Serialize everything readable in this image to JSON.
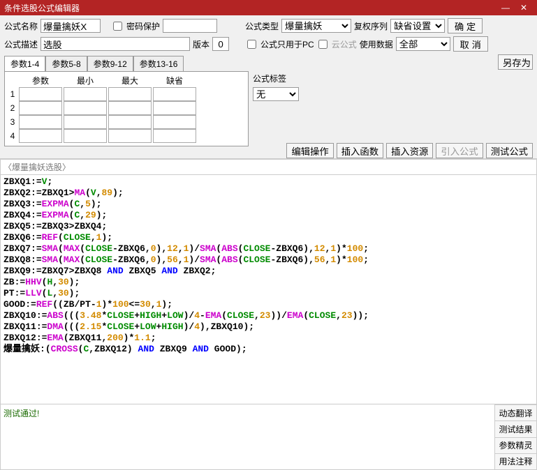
{
  "window": {
    "title": "条件选股公式编辑器"
  },
  "labels": {
    "name": "公式名称",
    "pwd": "密码保护",
    "type": "公式类型",
    "seq": "复权序列",
    "desc": "公式描述",
    "ver": "版本",
    "pconly": "公式只用于PC",
    "cloud": "云公式",
    "usedata": "使用数据",
    "tag": "公式标签"
  },
  "fields": {
    "name": "爆量擒妖X",
    "desc": "选股",
    "ver": "0",
    "type": "爆量擒妖",
    "seq": "缺省设置",
    "usedata": "全部",
    "tag": "无"
  },
  "buttons": {
    "ok": "确 定",
    "cancel": "取 消",
    "saveas": "另存为",
    "editop": "编辑操作",
    "insfn": "插入函数",
    "insres": "插入资源",
    "refform": "引入公式",
    "test": "测试公式"
  },
  "paramtabs": [
    "参数1-4",
    "参数5-8",
    "参数9-12",
    "参数13-16"
  ],
  "paramhdr": [
    "参数",
    "最小",
    "最大",
    "缺省"
  ],
  "paramrows": [
    "1",
    "2",
    "3",
    "4"
  ],
  "codeTitle": "〈爆量擒妖选股〉",
  "status": "测试通过!",
  "sidetabs": [
    "动态翻译",
    "测试结果",
    "参数精灵",
    "用法注释"
  ],
  "chart_data": {
    "type": "table",
    "title": "爆量擒妖选股 formula source",
    "lines": [
      "ZBXQ1:=V;",
      "ZBXQ2:=ZBXQ1>MA(V,89);",
      "ZBXQ3:=EXPMA(C,5);",
      "ZBXQ4:=EXPMA(C,29);",
      "ZBXQ5:=ZBXQ3>ZBXQ4;",
      "ZBXQ6:=REF(CLOSE,1);",
      "ZBXQ7:=SMA(MAX(CLOSE-ZBXQ6,0),12,1)/SMA(ABS(CLOSE-ZBXQ6),12,1)*100;",
      "ZBXQ8:=SMA(MAX(CLOSE-ZBXQ6,0),56,1)/SMA(ABS(CLOSE-ZBXQ6),56,1)*100;",
      "ZBXQ9:=ZBXQ7>ZBXQ8 AND ZBXQ5 AND ZBXQ2;",
      "ZB:=HHV(H,30);",
      "PT:=LLV(L,30);",
      "GOOD:=REF((ZB/PT-1)*100<=30,1);",
      "ZBXQ10:=ABS(((3.48*CLOSE+HIGH+LOW)/4-EMA(CLOSE,23))/EMA(CLOSE,23));",
      "ZBXQ11:=DMA(((2.15*CLOSE+LOW+HIGH)/4),ZBXQ10);",
      "ZBXQ12:=EMA(ZBXQ11,200)*1.1;",
      "爆量擒妖:(CROSS(C,ZBXQ12) AND ZBXQ9 AND GOOD);"
    ]
  }
}
